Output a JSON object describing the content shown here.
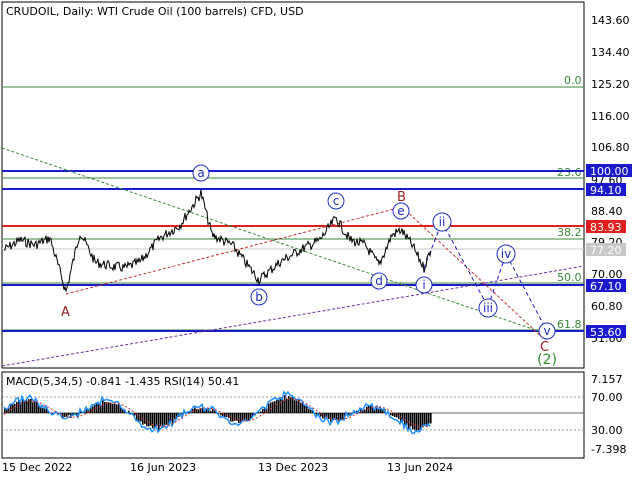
{
  "header": {
    "title": "CRUDOIL, Daily:  WTI Crude Oil (100 barrels) CFD, USD"
  },
  "price_axis": {
    "ticks": [
      "143.60",
      "134.40",
      "125.20",
      "116.00",
      "106.80",
      "97.60",
      "88.40",
      "79.20",
      "70.00",
      "60.80",
      "51.60"
    ]
  },
  "level_tags": [
    {
      "label": "100.00",
      "color": "#1a1acc"
    },
    {
      "label": "94.10",
      "color": "#1a1acc"
    },
    {
      "label": "83.93",
      "color": "#e02020"
    },
    {
      "label": "77.20",
      "color": "#c8c8c8"
    },
    {
      "label": "67.10",
      "color": "#1a1acc"
    },
    {
      "label": "53.60",
      "color": "#1a1acc"
    }
  ],
  "fib_labels": [
    "0.0",
    "23.6",
    "38.2",
    "50.0",
    "61.8"
  ],
  "wave_labels": {
    "red": [
      "A",
      "B",
      "C"
    ],
    "blue_circled": [
      "a",
      "b",
      "c",
      "d",
      "e",
      "i",
      "ii",
      "iii",
      "iv",
      "v"
    ],
    "green": [
      "(2)"
    ]
  },
  "indicator": {
    "title": "MACD(5,34,5) -0.841 -1.435 RSI(14) 50.41",
    "ticks": [
      "7.157",
      "70.00",
      "30.00",
      "-7.398"
    ]
  },
  "date_axis": {
    "labels": [
      "15 Dec 2022",
      "16 Jun 2023",
      "13 Dec 2023",
      "13 Jun 2024"
    ]
  },
  "colors": {
    "support_resistance_blue": "#1a1acc",
    "resistance_red": "#e02020",
    "fib_green": "#3a8a3a",
    "macd_bar": "#000000",
    "rsi_line": "#1e90ff"
  }
}
